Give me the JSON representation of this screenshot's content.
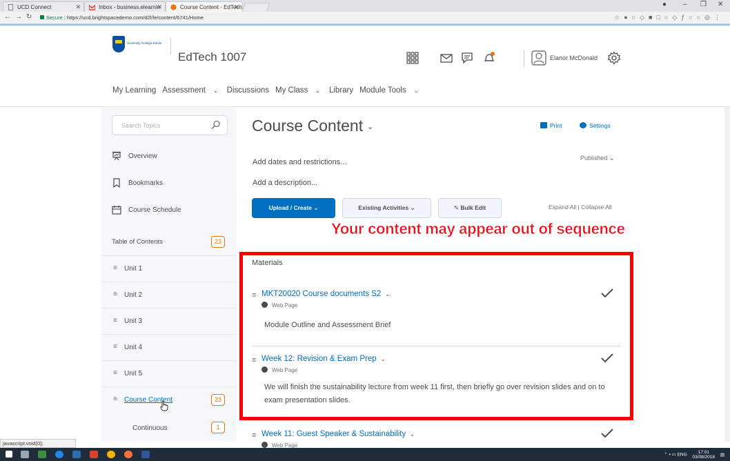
{
  "browser": {
    "tabs": [
      {
        "label": "UCD Connect",
        "active": false
      },
      {
        "label": "Inbox - business.elearnin",
        "active": false
      },
      {
        "label": "Course Content - EdTech",
        "active": true
      }
    ],
    "secure_label": "Secure",
    "url": "https://ucd.brightspacedemo.com/d2l/le/content/6741/Home",
    "status_text": "javascript:void(0);"
  },
  "header": {
    "course_name": "EdTech 1007",
    "user_name": "Elanor McDonald",
    "nav": [
      {
        "label": "My Learning",
        "dropdown": false
      },
      {
        "label": "Assessment",
        "dropdown": true
      },
      {
        "label": "Discussions",
        "dropdown": false
      },
      {
        "label": "My Class",
        "dropdown": true
      },
      {
        "label": "Library",
        "dropdown": false
      },
      {
        "label": "Module Tools",
        "dropdown": true
      }
    ]
  },
  "sidebar": {
    "search_placeholder": "Search Topics",
    "overview": "Overview",
    "bookmarks": "Bookmarks",
    "schedule": "Course Schedule",
    "toc_label": "Table of Contents",
    "toc_count": "23",
    "units": [
      {
        "label": "Unit 1"
      },
      {
        "label": "Unit 2"
      },
      {
        "label": "Unit 3"
      },
      {
        "label": "Unit 4"
      },
      {
        "label": "Unit 5"
      },
      {
        "label": "Course Content",
        "count": "23"
      },
      {
        "label": "Continuous",
        "count": "1"
      }
    ]
  },
  "content": {
    "title": "Course Content",
    "print": "Print",
    "settings": "Settings",
    "add_dates": "Add dates and restrictions...",
    "published": "Published",
    "add_description": "Add a description...",
    "upload_button": "Upload / Create",
    "existing_button": "Existing Activities",
    "bulk_edit_button": "Bulk Edit",
    "expand_all": "Expand All",
    "collapse_all": "Collapse All",
    "warning": "Your content may appear out of sequence",
    "materials_heading": "Materials",
    "topics": [
      {
        "title": "MKT20020 Course documents S2",
        "type": "Web Page",
        "description": "Module Outline and Assessment Brief"
      },
      {
        "title": "Week 12: Revision & Exam Prep",
        "type": "Web Page",
        "description": "We will finish the sustainability lecture from week 11 first, then briefly go over revision slides and on to exam presentation slides."
      },
      {
        "title": "Week 11: Guest Speaker & Sustainability",
        "type": "Web Page",
        "description": ""
      }
    ]
  },
  "taskbar": {
    "tray_lang": "ENG",
    "time": "17:01",
    "date": "03/08/2018"
  },
  "colors": {
    "brand_blue": "#006fbf",
    "badge_orange": "#e87511",
    "annotation_red": "#ff0000"
  }
}
